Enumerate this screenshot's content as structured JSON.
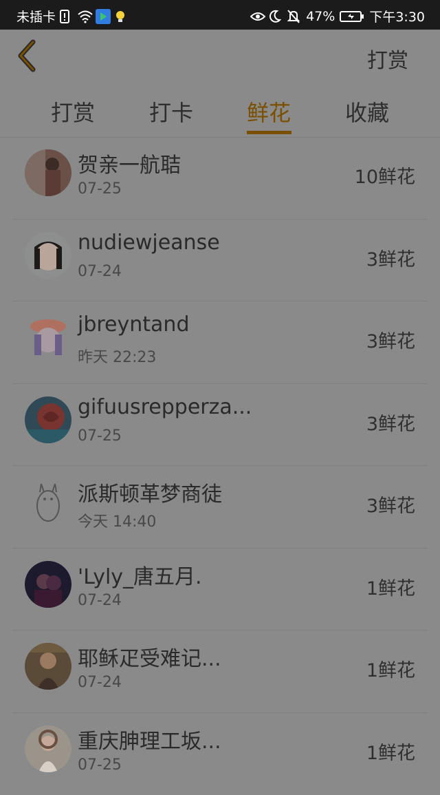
{
  "status_bar": {
    "carrier": "未插卡",
    "battery": "47%",
    "time": "下午3:30"
  },
  "header": {
    "back_icon": "chevron-left-icon",
    "action_label": "打赏"
  },
  "tabs": [
    {
      "label": "打赏"
    },
    {
      "label": "打卡"
    },
    {
      "label": "鲜花",
      "active": true
    },
    {
      "label": "收藏"
    }
  ],
  "list": [
    {
      "name": "贺亲一航聐",
      "date": "07-25",
      "amount": "10鲜花"
    },
    {
      "name": "nudiewjeanse",
      "date": "07-24",
      "amount": "3鲜花"
    },
    {
      "name": "jbreyntand",
      "date": "昨天 22:23",
      "amount": "3鲜花"
    },
    {
      "name": "gifuusrepperza...",
      "date": "07-25",
      "amount": "3鲜花"
    },
    {
      "name": "派斯顿革梦商徒",
      "date": "今天 14:40",
      "amount": "3鲜花"
    },
    {
      "name": "'Lyly_唐五月.",
      "date": "07-24",
      "amount": "1鲜花"
    },
    {
      "name": "耶稣疋受难记...",
      "date": "07-24",
      "amount": "1鲜花"
    },
    {
      "name": "重庆胂理工坂...",
      "date": "07-25",
      "amount": "1鲜花"
    }
  ],
  "colors": {
    "accent": "#7a4f00",
    "overlay_background": "#8a8a8a",
    "status_bar": "#1b1b1b"
  }
}
